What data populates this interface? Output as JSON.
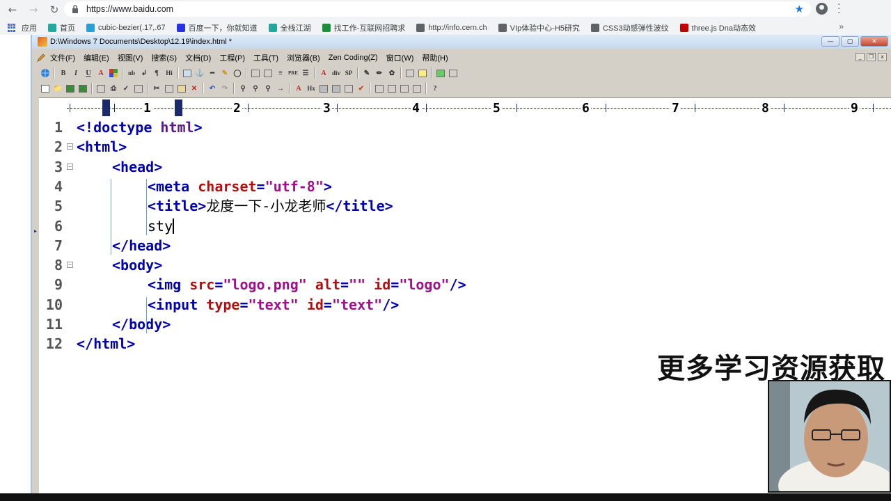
{
  "browser": {
    "url": "https://www.baidu.com",
    "bookmarks": [
      {
        "label": "应用",
        "icon": "apps-grid-icon",
        "color": "#3c6fd8"
      },
      {
        "label": "首页",
        "icon": "code-brackets-icon",
        "color": "#23a8a0"
      },
      {
        "label": "cubic-bezier(.17,.67",
        "icon": "site-icon",
        "color": "#2a9fd6"
      },
      {
        "label": "百度一下，你就知道",
        "icon": "paw-icon",
        "color": "#2932e1"
      },
      {
        "label": "全栈江湖",
        "icon": "code-brackets-icon",
        "color": "#23a8a0"
      },
      {
        "label": "找工作-互联网招聘求",
        "icon": "l-icon",
        "color": "#1d8f3a"
      },
      {
        "label": "http://info.cern.ch",
        "icon": "search-icon",
        "color": "#5f6368"
      },
      {
        "label": "VIp体验中心-H5研究",
        "icon": "page-icon",
        "color": "#5f6368"
      },
      {
        "label": "CSS3动感弹性波纹",
        "icon": "page-icon",
        "color": "#5f6368"
      },
      {
        "label": "three.js Dna动态效",
        "icon": "red-circle-icon",
        "color": "#c00000"
      }
    ],
    "more": "»"
  },
  "editor": {
    "title": "D:\\Windows 7 Documents\\Desktop\\12.19\\index.html *",
    "menus": [
      "文件(F)",
      "编辑(E)",
      "视图(V)",
      "搜索(S)",
      "文档(D)",
      "工程(P)",
      "工具(T)",
      "浏览器(B)",
      "Zen Coding(Z)",
      "窗口(W)",
      "帮助(H)"
    ],
    "ruler_numbers": [
      "1",
      "2",
      "3",
      "4",
      "5",
      "6",
      "7",
      "8",
      "9"
    ],
    "lines": [
      {
        "n": "1",
        "indent": 0,
        "fold": false,
        "tokens": [
          [
            "tag",
            "<!doctype "
          ],
          [
            "kw",
            "html"
          ],
          [
            "tag",
            ">"
          ]
        ]
      },
      {
        "n": "2",
        "indent": 0,
        "fold": true,
        "tokens": [
          [
            "tag",
            "<html>"
          ]
        ]
      },
      {
        "n": "3",
        "indent": 1,
        "fold": true,
        "tokens": [
          [
            "tag",
            "<head>"
          ]
        ]
      },
      {
        "n": "4",
        "indent": 2,
        "fold": false,
        "tokens": [
          [
            "tag",
            "<meta "
          ],
          [
            "attr",
            "charset"
          ],
          [
            "tag",
            "="
          ],
          [
            "val",
            "\"utf-8\""
          ],
          [
            "tag",
            ">"
          ]
        ]
      },
      {
        "n": "5",
        "indent": 2,
        "fold": false,
        "tokens": [
          [
            "tag",
            "<title>"
          ],
          [
            "txt",
            "龙度一下-小龙老师"
          ],
          [
            "tag",
            "</title>"
          ]
        ]
      },
      {
        "n": "6",
        "indent": 2,
        "fold": false,
        "marker": true,
        "caret": true,
        "tokens": [
          [
            "txt",
            "sty"
          ]
        ]
      },
      {
        "n": "7",
        "indent": 1,
        "fold": false,
        "tokens": [
          [
            "tag",
            "</head>"
          ]
        ]
      },
      {
        "n": "8",
        "indent": 1,
        "fold": true,
        "tokens": [
          [
            "tag",
            "<body>"
          ]
        ]
      },
      {
        "n": "9",
        "indent": 2,
        "fold": false,
        "tokens": [
          [
            "tag",
            "<img "
          ],
          [
            "attr",
            "src"
          ],
          [
            "tag",
            "="
          ],
          [
            "val",
            "\"logo.png\""
          ],
          [
            "tag",
            " "
          ],
          [
            "attr",
            "alt"
          ],
          [
            "tag",
            "="
          ],
          [
            "val",
            "\"\""
          ],
          [
            "tag",
            " "
          ],
          [
            "attr",
            "id"
          ],
          [
            "tag",
            "="
          ],
          [
            "val",
            "\"logo\""
          ],
          [
            "tag",
            "/>"
          ]
        ]
      },
      {
        "n": "10",
        "indent": 2,
        "fold": false,
        "tokens": [
          [
            "tag",
            "<input "
          ],
          [
            "attr",
            "type"
          ],
          [
            "tag",
            "="
          ],
          [
            "val",
            "\"text\""
          ],
          [
            "tag",
            " "
          ],
          [
            "attr",
            "id"
          ],
          [
            "tag",
            "="
          ],
          [
            "val",
            "\"text\""
          ],
          [
            "tag",
            "/>"
          ]
        ]
      },
      {
        "n": "11",
        "indent": 1,
        "fold": false,
        "tokens": [
          [
            "tag",
            "</body>"
          ]
        ]
      },
      {
        "n": "12",
        "indent": 0,
        "fold": false,
        "tokens": [
          [
            "tag",
            "</html>"
          ]
        ]
      }
    ]
  },
  "overlay": {
    "text": "更多学习资源获取"
  },
  "colors": {
    "tag": "#0000b0",
    "attr": "#b01010",
    "value": "#a0108c",
    "ruler": "#1a2a6c"
  }
}
